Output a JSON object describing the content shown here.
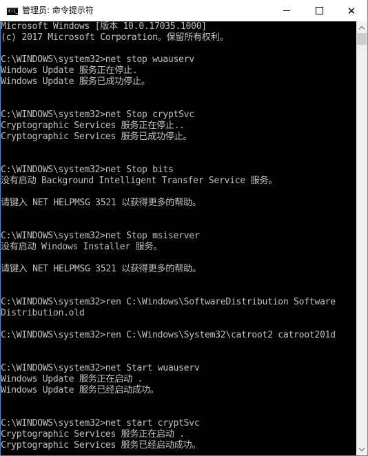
{
  "window": {
    "title": "管理员: 命令提示符",
    "app_icon": "cmd-icon",
    "app_icon_text": "C:\\_",
    "controls": {
      "minimize": "minimize-icon",
      "maximize": "maximize-icon",
      "close": "close-icon",
      "close_glyph": "✕"
    }
  },
  "console": {
    "lines": [
      "Microsoft Windows [版本 10.0.17035.1000]",
      "(c) 2017 Microsoft Corporation。保留所有权利。",
      "",
      "C:\\WINDOWS\\system32>net stop wuauserv",
      "Windows Update 服务正在停止.",
      "Windows Update 服务已成功停止。",
      "",
      "",
      "C:\\WINDOWS\\system32>net Stop cryptSvc",
      "Cryptographic Services 服务正在停止..",
      "Cryptographic Services 服务已成功停止。",
      "",
      "",
      "C:\\WINDOWS\\system32>net Stop bits",
      "没有启动 Background Intelligent Transfer Service 服务。",
      "",
      "请键入 NET HELPMSG 3521 以获得更多的帮助。",
      "",
      "",
      "C:\\WINDOWS\\system32>net Stop msiserver",
      "没有启动 Windows Installer 服务。",
      "",
      "请键入 NET HELPMSG 3521 以获得更多的帮助。",
      "",
      "",
      "C:\\WINDOWS\\system32>ren C:\\Windows\\SoftwareDistribution Software",
      "Distribution.old",
      "",
      "C:\\WINDOWS\\system32>ren C:\\Windows\\System32\\catroot2 catroot201d",
      "",
      "",
      "C:\\WINDOWS\\system32>net Start wuauserv",
      "Windows Update 服务正在启动 .",
      "Windows Update 服务已经启动成功。",
      "",
      "",
      "C:\\WINDOWS\\system32>net start cryptSvc",
      "Cryptographic Services 服务正在启动 .",
      "Cryptographic Services 服务已经启动成功。"
    ]
  },
  "scrollbar": {
    "up_icon": "chevron-up-icon",
    "down_icon": "chevron-down-icon"
  },
  "colors": {
    "console_bg": "#000000",
    "console_text": "#c0c0c0",
    "window_border": "#3c8fd8"
  }
}
